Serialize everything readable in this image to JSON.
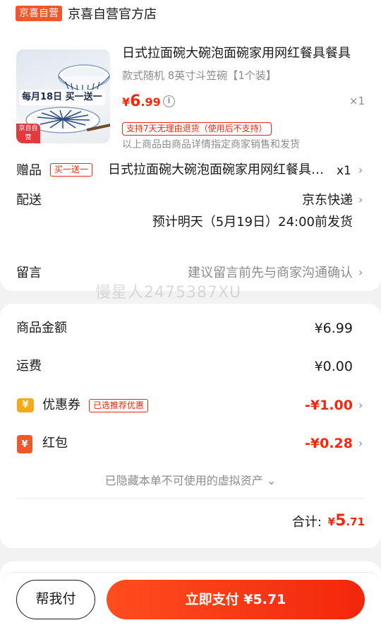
{
  "store": {
    "badge": "京喜自营",
    "name": "京喜自营官方店"
  },
  "product": {
    "image_banner": "每月18日 买一送一",
    "image_tag": "京喜自营\n包邮",
    "title": "日式拉面碗大碗泡面碗家用网红餐具餐具",
    "spec": "款式随机 8英寸斗笠碗【1个装】",
    "price_symbol": "¥",
    "price_int": "6",
    "price_dec": ".99",
    "info_icon": "ⓘ",
    "qty": "×1",
    "return_policy": "支持7天无理由退货（使用后不支持）",
    "sales_note": "以上商品由商品详情指定商家销售和发货"
  },
  "gift": {
    "label": "赠品",
    "tag": "买一送一",
    "text": "日式拉面碗大碗泡面碗家用网红餐具餐具",
    "qty": "x1"
  },
  "delivery": {
    "label": "配送",
    "method": "京东快递",
    "estimate": "预计明天（5月19日）24:00前发货"
  },
  "message": {
    "label": "留言",
    "placeholder": "建议留言前先与商家沟通确认"
  },
  "watermark": "慢星人2475387XU",
  "summary": {
    "goods_label": "商品金额",
    "goods_value": "¥6.99",
    "shipping_label": "运费",
    "shipping_value": "¥0.00",
    "coupon_label": "优惠券",
    "coupon_tag": "已选推荐优惠",
    "coupon_value": "-¥1.00",
    "redpacket_label": "红包",
    "redpacket_value": "-¥0.28",
    "hidden_assets": "已隐藏本单不可使用的虚拟资产 ⌄",
    "total_label": "合计:",
    "total_symbol": "¥",
    "total_int": "5",
    "total_dec": ".71"
  },
  "actions": {
    "help_pay": "帮我付",
    "pay_now": "立即支付 ¥5.71"
  },
  "icons": {
    "chevron": "›",
    "coupon_icon": "¥",
    "redpacket_icon": "¥"
  },
  "colors": {
    "accent": "#f2270c",
    "brand_orange": "#f2572b",
    "coupon_yellow": "#f7a81b"
  }
}
